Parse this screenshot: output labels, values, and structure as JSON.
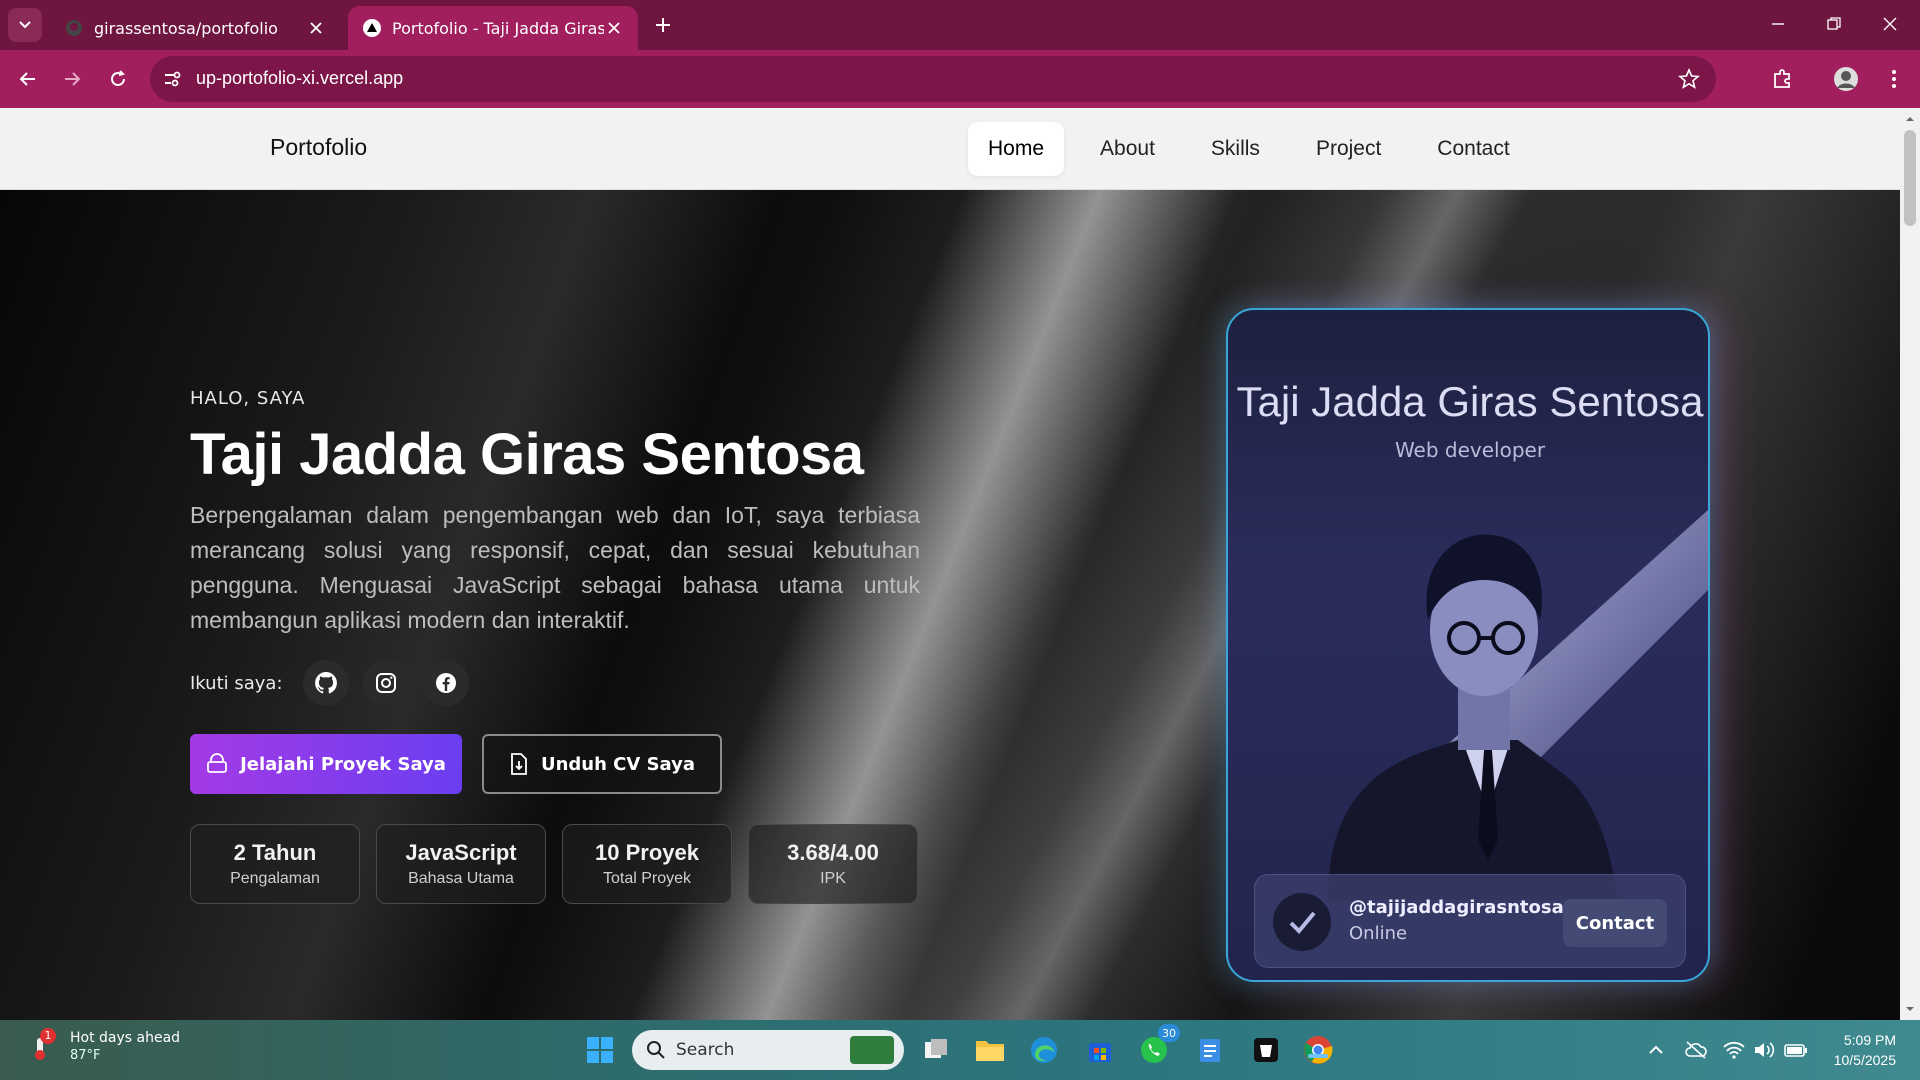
{
  "browser": {
    "tabs": [
      {
        "title": "girassentosa/portofolio",
        "active": false,
        "icon": "github-icon"
      },
      {
        "title": "Portofolio - Taji Jadda Giras Sentosa",
        "active": true,
        "icon": "vercel-icon"
      }
    ],
    "url": "up-portofolio-xi.vercel.app",
    "accent": "#a11f5d",
    "tabbar_color": "#6e1540"
  },
  "site": {
    "brand": "Portofolio",
    "nav": [
      {
        "label": "Home",
        "active": true
      },
      {
        "label": "About",
        "active": false
      },
      {
        "label": "Skills",
        "active": false
      },
      {
        "label": "Project",
        "active": false
      },
      {
        "label": "Contact",
        "active": false
      }
    ]
  },
  "hero": {
    "greeting": "HALO, SAYA",
    "name": "Taji Jadda Giras Sentosa",
    "description": "Berpengalaman dalam pengembangan web dan IoT, saya terbiasa merancang solusi yang responsif, cepat, dan sesuai kebutuhan pengguna. Menguasai JavaScript sebagai bahasa utama untuk membangun aplikasi modern dan interaktif.",
    "follow_label": "Ikuti saya:",
    "socials": [
      "github-icon",
      "instagram-icon",
      "facebook-icon"
    ],
    "primary_button": "Jelajahi Proyek Saya",
    "secondary_button": "Unduh CV Saya",
    "stats": [
      {
        "value": "2 Tahun",
        "label": "Pengalaman"
      },
      {
        "value": "JavaScript",
        "label": "Bahasa Utama"
      },
      {
        "value": "10 Proyek",
        "label": "Total Proyek"
      },
      {
        "value": "3.68/4.00",
        "label": "IPK"
      }
    ]
  },
  "card": {
    "name": "Taji Jadda Giras Sentosa",
    "role": "Web developer",
    "handle": "@tajijaddagirasntosa",
    "status": "Online",
    "contact_button": "Contact"
  },
  "taskbar": {
    "weather_title": "Hot days ahead",
    "weather_temp": "87°F",
    "weather_badge": "1",
    "search_placeholder": "Search",
    "whatsapp_badge": "30",
    "time": "5:09 PM",
    "date": "10/5/2025"
  }
}
